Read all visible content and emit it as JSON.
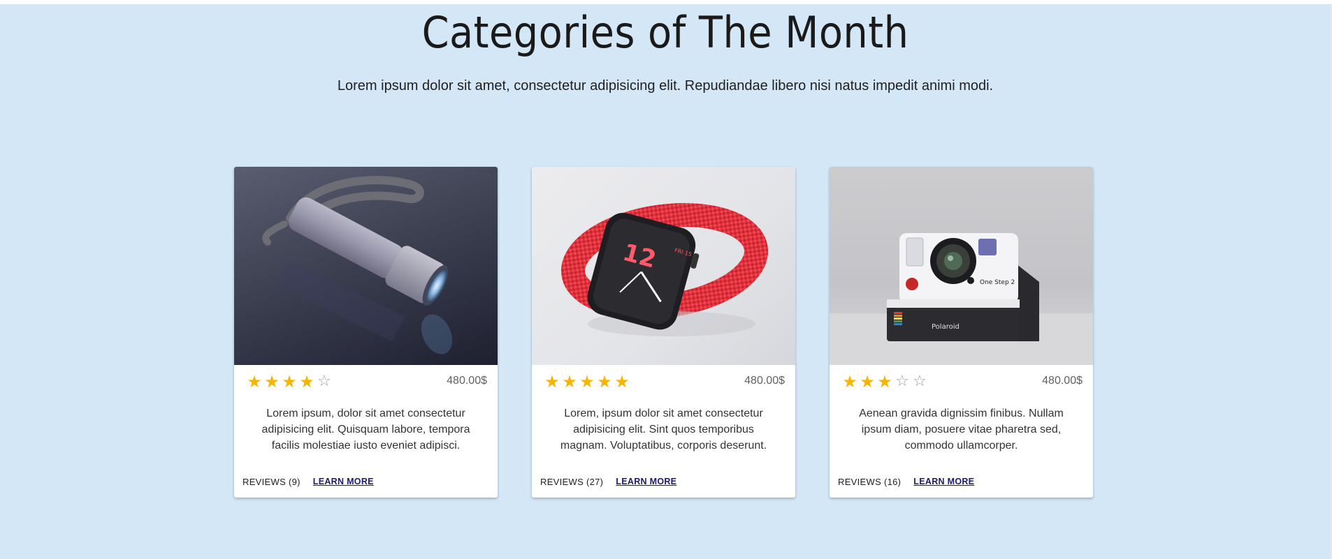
{
  "section": {
    "title": "Categories of The Month",
    "subtitle": "Lorem ipsum dolor sit amet, consectetur adipisicing elit. Repudiandae libero nisi natus impedit animi modi."
  },
  "colors": {
    "background": "#d4e7f7",
    "star": "#f7b500",
    "card": "#ffffff"
  },
  "cards": [
    {
      "image_icon": "flashlight-image",
      "rating": 4,
      "max_rating": 5,
      "price": "480.00$",
      "text": "Lorem ipsum, dolor sit amet consectetur adipisicing elit. Quisquam labore, tempora facilis molestiae iusto eveniet adipisci.",
      "reviews": "REVIEWS (9)",
      "learn_more": "LEARN MORE"
    },
    {
      "image_icon": "smartwatch-image",
      "rating": 5,
      "max_rating": 5,
      "price": "480.00$",
      "text": "Lorem, ipsum dolor sit amet consectetur adipisicing elit. Sint quos temporibus magnam. Voluptatibus, corporis deserunt.",
      "reviews": "REVIEWS (27)",
      "learn_more": "LEARN MORE"
    },
    {
      "image_icon": "instant-camera-image",
      "rating": 3,
      "max_rating": 5,
      "price": "480.00$",
      "text": "Aenean gravida dignissim finibus. Nullam ipsum diam, posuere vitae pharetra sed, commodo ullamcorper.",
      "reviews": "REVIEWS (16)",
      "learn_more": "LEARN MORE",
      "camera_brand": "Polaroid",
      "camera_model": "One Step 2"
    }
  ]
}
